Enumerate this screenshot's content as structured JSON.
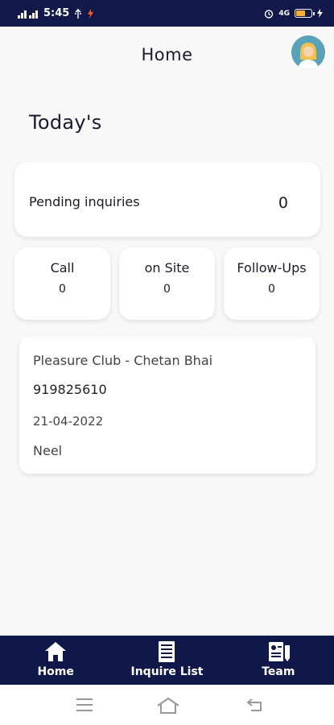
{
  "status_bar": {
    "network": "4G",
    "time": "5:45",
    "battery_level": 0.6,
    "battery_color": "#f2b134"
  },
  "header": {
    "title": "Home",
    "avatar_icon": "user-avatar-icon"
  },
  "today": {
    "heading": "Today's",
    "pending_label": "Pending inquiries",
    "pending_count": "0",
    "stats": [
      {
        "label": "Call",
        "value": "0"
      },
      {
        "label": "on Site",
        "value": "0"
      },
      {
        "label": "Follow-Ups",
        "value": "0"
      }
    ]
  },
  "inquiry": {
    "name": "Pleasure Club - Chetan Bhai",
    "phone": "919825610",
    "date": "21-04-2022",
    "assignee": "Neel"
  },
  "bottom_nav": {
    "items": [
      {
        "label": "Home",
        "icon": "home-icon"
      },
      {
        "label": "Inquire List",
        "icon": "list-icon"
      },
      {
        "label": "Team",
        "icon": "team-icon"
      }
    ]
  },
  "colors": {
    "nav_bg": "#0f1848",
    "status_bg": "#12194a",
    "text": "#1a1a2e"
  }
}
